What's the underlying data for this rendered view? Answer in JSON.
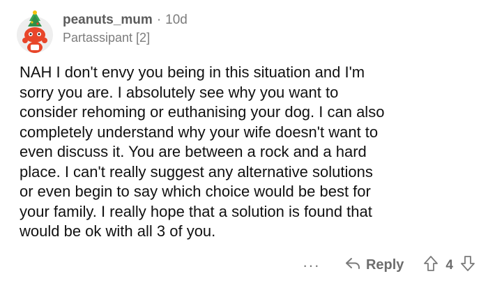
{
  "comment": {
    "author": "peanuts_mum",
    "separator": "·",
    "age": "10d",
    "flair": "Partassipant [2]",
    "body": "NAH I don't envy you being in this situation and I'm\nsorry you are.  I absolutely see why you want to\nconsider rehoming or euthanising your dog. I can also\ncompletely understand why your wife doesn't want to\neven discuss it.  You are between a rock and a hard\nplace.   I can't really suggest any alternative solutions\nor even begin to say which choice would be best for\nyour family.  I really hope that a solution is found that\nwould be ok with all 3 of you."
  },
  "actions": {
    "more": "···",
    "reply_label": "Reply",
    "score": "4"
  },
  "icons": {
    "avatar": "snoo-avatar-icon",
    "reply": "reply-arrow-icon",
    "upvote": "upvote-arrow-icon",
    "downvote": "downvote-arrow-icon",
    "more": "more-options-icon"
  },
  "colors": {
    "meta": "#7c7c7c",
    "avatar_red": "#e8462a",
    "avatar_green": "#3aa757"
  }
}
